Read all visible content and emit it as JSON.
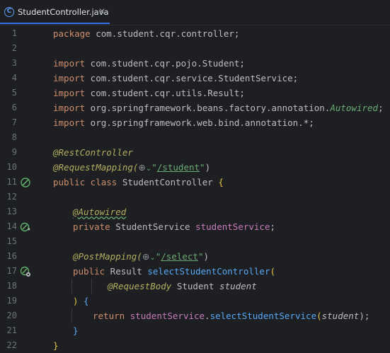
{
  "tab": {
    "icon": "class-icon",
    "icon_letter": "C",
    "title": "StudentController.java",
    "close": "✕"
  },
  "lines": [
    {
      "n": "1"
    },
    {
      "n": "2"
    },
    {
      "n": "3"
    },
    {
      "n": "4"
    },
    {
      "n": "5"
    },
    {
      "n": "6"
    },
    {
      "n": "7"
    },
    {
      "n": "8"
    },
    {
      "n": "9"
    },
    {
      "n": "10"
    },
    {
      "n": "11"
    },
    {
      "n": "12"
    },
    {
      "n": "13"
    },
    {
      "n": "14"
    },
    {
      "n": "15"
    },
    {
      "n": "16"
    },
    {
      "n": "17"
    },
    {
      "n": "18"
    },
    {
      "n": "19"
    },
    {
      "n": "20"
    },
    {
      "n": "21"
    },
    {
      "n": "22"
    }
  ],
  "code": {
    "l1": {
      "kw": "package",
      "rest": " com.student.cqr.controller;"
    },
    "l3": {
      "kw": "import",
      "rest": " com.student.cqr.pojo.Student;"
    },
    "l4": {
      "kw": "import",
      "rest": " com.student.cqr.service.StudentService;"
    },
    "l5": {
      "kw": "import",
      "rest": " com.student.cqr.utils.Result;"
    },
    "l6": {
      "kw": "import",
      "rest": " org.springframework.beans.factory.annotation.",
      "ann": "Autowired",
      "end": ";"
    },
    "l7": {
      "kw": "import",
      "rest": " org.springframework.web.bind.annotation.*;"
    },
    "l9": {
      "ann": "@RestController"
    },
    "l10": {
      "ann": "@RequestMapping(",
      "globe": "⊕",
      "chev": "⌄",
      "q1": "\"",
      "path": "/student",
      "q2": "\"",
      "end": ")"
    },
    "l11": {
      "kw1": "public",
      "kw2": " class",
      "name": " StudentController ",
      "brace": "{"
    },
    "l13": {
      "ann": "@Autowired"
    },
    "l14": {
      "kw": "private",
      "type": " StudentService ",
      "field": "studentService",
      "end": ";"
    },
    "l16": {
      "ann": "@PostMapping(",
      "globe": "⊕",
      "chev": "⌄",
      "q1": "\"",
      "path": "/select",
      "q2": "\"",
      "end": ")"
    },
    "l17": {
      "kw": "public",
      "type": " Result ",
      "method": "selectStudentController",
      "paren": "("
    },
    "l18": {
      "ann": "@RequestBody",
      "type": " Student ",
      "param": "student"
    },
    "l19": {
      "paren": ")",
      "brace": " {"
    },
    "l20": {
      "kw": "return",
      "sp": " ",
      "field": "studentService",
      "dot": ".",
      "method": "selectStudentService",
      "p1": "(",
      "param": "student",
      "p2": ");"
    },
    "l21": {
      "brace": "}"
    },
    "l22": {
      "brace": "}"
    }
  },
  "gutter": {
    "l11": "bean-icon",
    "l14": "injected-bean-icon",
    "l17": "endpoint-icon"
  },
  "colors": {
    "background": "#1e1f22",
    "keyword": "#cf8e6d",
    "annotation": "#b3ae60",
    "string": "#6aab73",
    "field": "#c77dbb",
    "method": "#56a8f5",
    "text": "#bcbec4",
    "line_number": "#6f737a",
    "accent": "#3574f0"
  }
}
